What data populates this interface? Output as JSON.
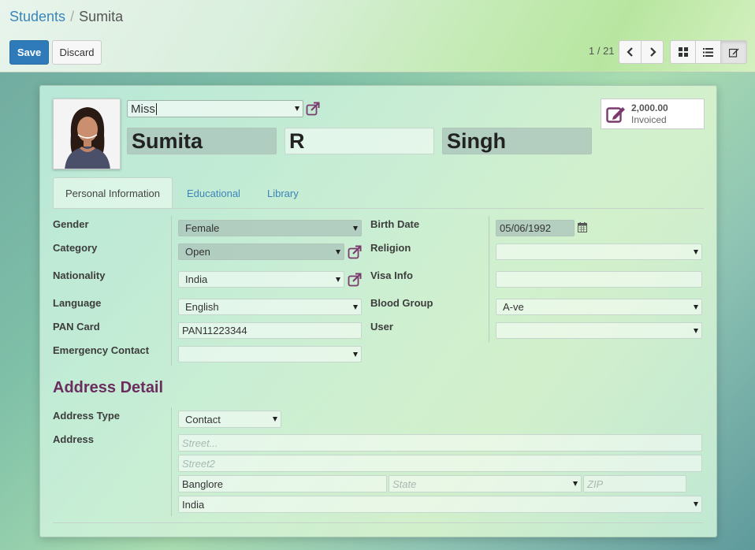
{
  "breadcrumb": {
    "parent": "Students",
    "separator": "/",
    "current": "Sumita"
  },
  "toolbar": {
    "save_label": "Save",
    "discard_label": "Discard"
  },
  "pager": {
    "value": "1 / 21"
  },
  "stat_button": {
    "amount": "2,000.00",
    "label": "Invoiced"
  },
  "header": {
    "title_select": "Miss",
    "first_name": "Sumita",
    "middle_name": "R",
    "last_name": "Singh"
  },
  "tabs": [
    {
      "label": "Personal Information",
      "active": true
    },
    {
      "label": "Educational",
      "active": false
    },
    {
      "label": "Library",
      "active": false
    }
  ],
  "personal": {
    "gender": {
      "label": "Gender",
      "value": "Female"
    },
    "category": {
      "label": "Category",
      "value": "Open"
    },
    "nationality": {
      "label": "Nationality",
      "value": "India"
    },
    "language": {
      "label": "Language",
      "value": "English"
    },
    "pan_card": {
      "label": "PAN Card",
      "value": "PAN11223344"
    },
    "emergency_contact": {
      "label": "Emergency Contact",
      "value": ""
    },
    "birth_date": {
      "label": "Birth Date",
      "value": "05/06/1992"
    },
    "religion": {
      "label": "Religion",
      "value": ""
    },
    "visa_info": {
      "label": "Visa Info",
      "value": ""
    },
    "blood_group": {
      "label": "Blood Group",
      "value": "A-ve"
    },
    "user": {
      "label": "User",
      "value": ""
    }
  },
  "address": {
    "section_title": "Address Detail",
    "type_label": "Address Type",
    "type_value": "Contact",
    "address_label": "Address",
    "street_placeholder": "Street...",
    "street2_placeholder": "Street2",
    "city": "Banglore",
    "state_placeholder": "State",
    "zip_placeholder": "ZIP",
    "country": "India"
  },
  "colors": {
    "primary": "#2f7bba",
    "link": "#3c85b8",
    "section_title": "#6b2c5e",
    "icon_accent": "#7b3a6e"
  }
}
